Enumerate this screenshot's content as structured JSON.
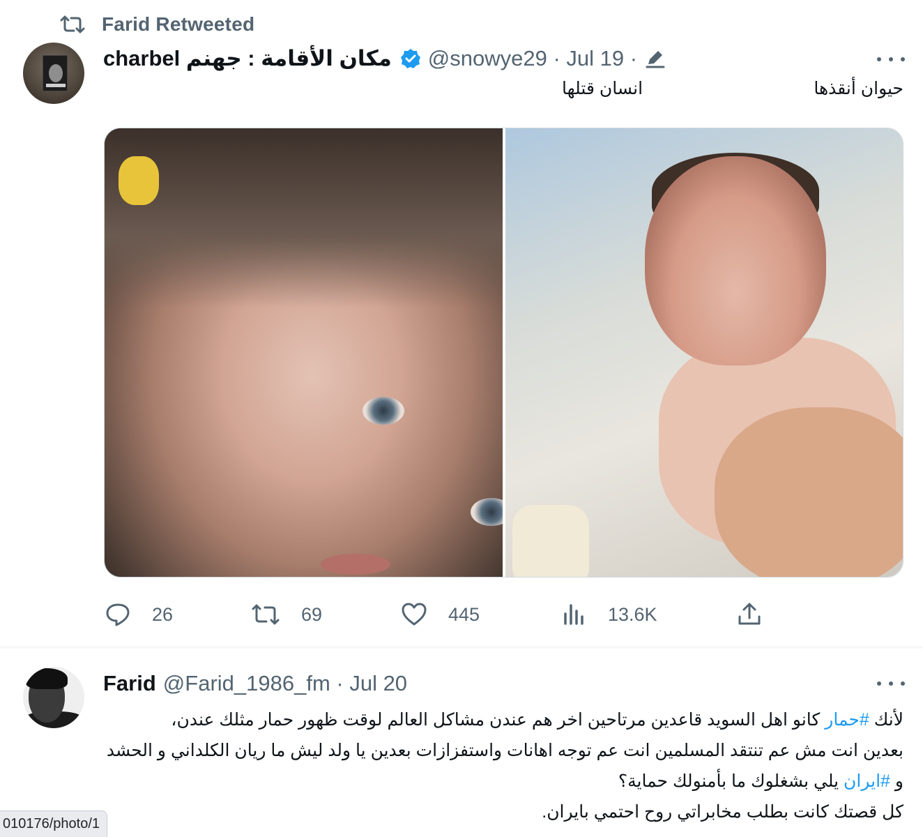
{
  "retweet_banner": {
    "icon": "retweet-icon",
    "text": "Farid Retweeted"
  },
  "tweet1": {
    "author_name": "charbel مكان الأقامة : جهنم",
    "handle_date": "@snowye29 · Jul 19 ·",
    "text_right": "حيوان أنقذها",
    "text_left": "انسان قتلها",
    "media_description_none": "",
    "stats": {
      "replies": "26",
      "retweets": "69",
      "likes": "445",
      "views": "13.6K"
    }
  },
  "tweet2": {
    "author_name": "Farid",
    "handle_date": "@Farid_1986_fm · Jul 20",
    "line1_pre": "لأنك ",
    "line1_hashtag": "#حمار",
    "line1_post": " كانو اهل السويد قاعدين مرتاحين اخر هم عندن مشاكل العالم لوقت ظهور حمار مثلك عندن،",
    "line2": "بعدين انت مش عم تنتقد المسلمين انت عم توجه اهانات واستفزازات بعدين يا ولد ليش ما ريان الكلداني و الحشد",
    "line3_pre": "و ",
    "line3_hashtag": "#ايران",
    "line3_post": " يلي بشغلوك ما بأمنولك حماية؟",
    "line4": "كل قصتك كانت بطلب مخابراتي روح احتمي بايران."
  },
  "status_bar": {
    "url": "010176/photo/1"
  },
  "colors": {
    "accent": "#1d9bf0",
    "muted": "#536471",
    "text": "#0f1419"
  }
}
